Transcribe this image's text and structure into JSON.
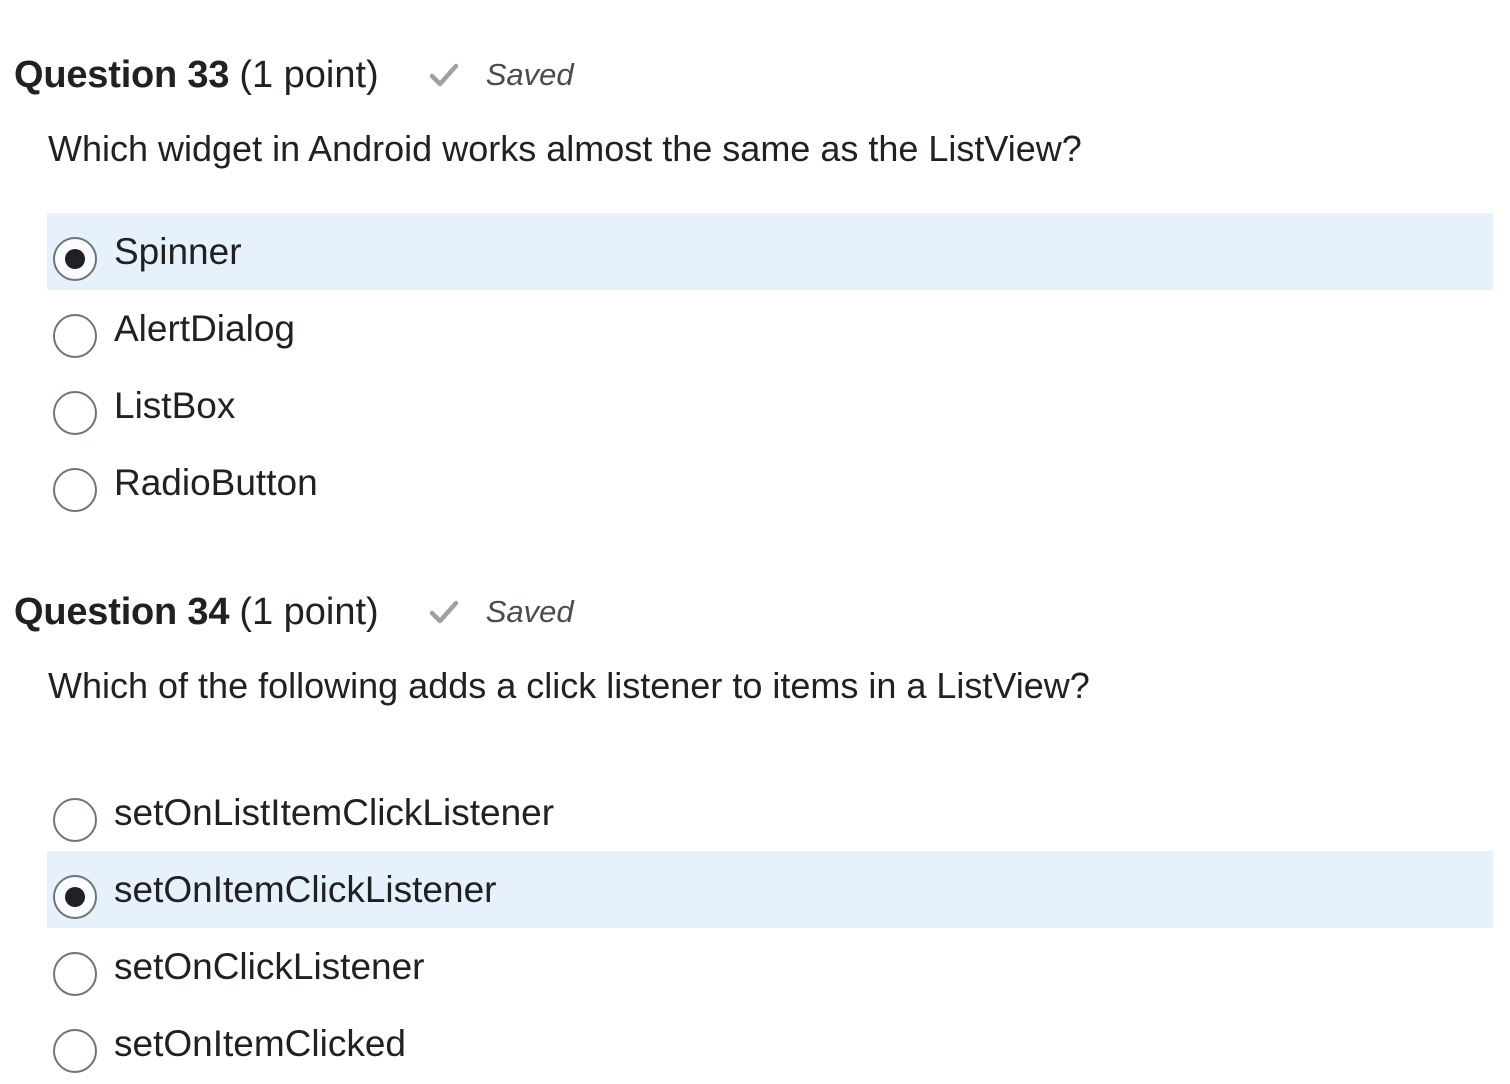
{
  "questions": [
    {
      "title": "Question 33",
      "points": "(1 point)",
      "status": "Saved",
      "status_icon": "check-icon",
      "text": "Which widget in Android works almost the same as the ListView?",
      "options": [
        {
          "label": "Spinner",
          "selected": true
        },
        {
          "label": "AlertDialog",
          "selected": false
        },
        {
          "label": "ListBox",
          "selected": false
        },
        {
          "label": "RadioButton",
          "selected": false
        }
      ]
    },
    {
      "title": "Question 34",
      "points": "(1 point)",
      "status": "Saved",
      "status_icon": "check-icon",
      "text": "Which of the following adds a click listener to items in a ListView?",
      "options": [
        {
          "label": "setOnListItemClickListener",
          "selected": false
        },
        {
          "label": "setOnItemClickListener",
          "selected": true
        },
        {
          "label": "setOnClickListener",
          "selected": false
        },
        {
          "label": "setOnItemClicked",
          "selected": false
        }
      ]
    }
  ],
  "colors": {
    "selected_row_bg": "#e6f1fb",
    "text": "#202122",
    "saved_text": "#494c4e",
    "check": "#9ea1a3",
    "radio_border": "#6e7477"
  }
}
